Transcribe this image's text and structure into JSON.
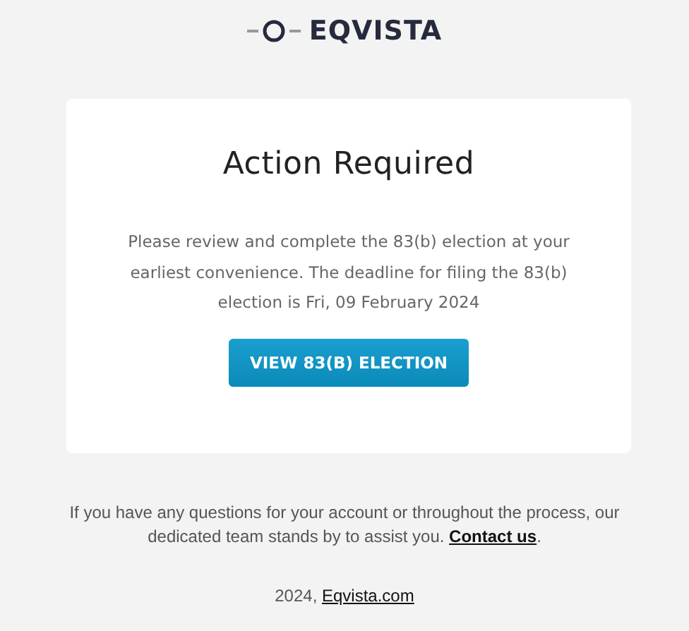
{
  "logo": {
    "name": "EQVISTA"
  },
  "card": {
    "title": "Action Required",
    "message": "Please review and complete the 83(b) election at your earliest convenience. The deadline for filing the 83(b) election is Fri, 09 February 2024",
    "button": "VIEW 83(B) ELECTION"
  },
  "footer": {
    "text_before": "If you have any questions for your account or throughout the process, our dedicated team stands by to assist you. ",
    "link": "Contact us",
    "text_after": ".",
    "copyright_prefix": "2024, ",
    "copyright_link": "Eqvista.com"
  }
}
